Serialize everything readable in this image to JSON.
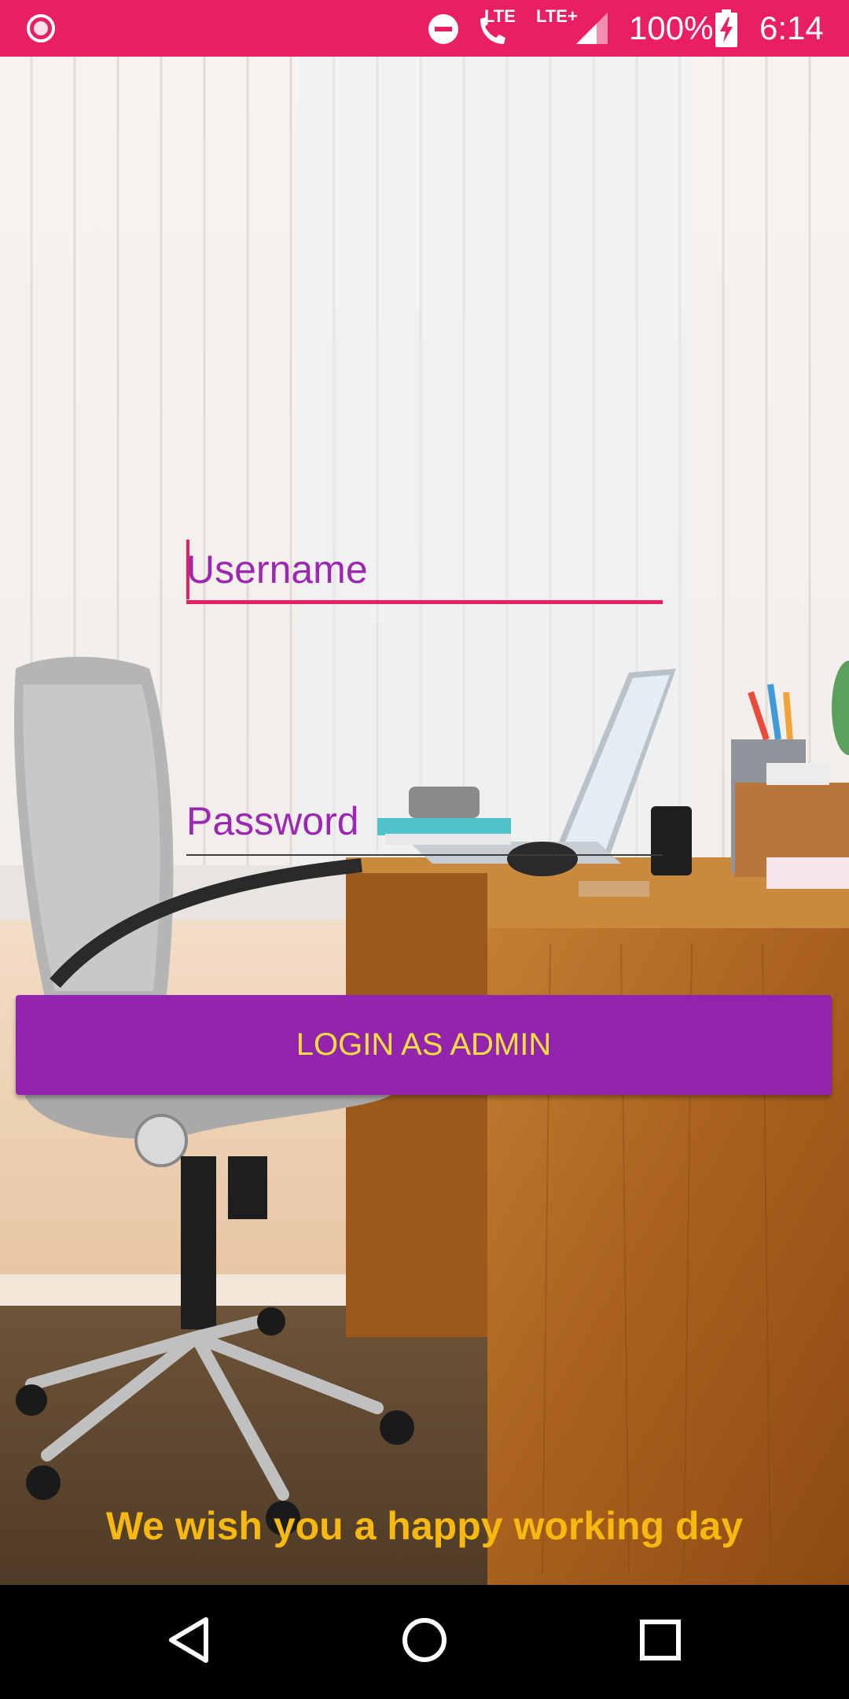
{
  "status_bar": {
    "battery_text": "100%",
    "time": "6:14",
    "network_1": "LTE",
    "network_2": "LTE+",
    "icons": [
      "recording-dot-icon",
      "do-not-disturb-icon",
      "wifi-calling-icon",
      "signal-icon",
      "battery-charging-icon"
    ]
  },
  "login_form": {
    "username_placeholder": "Username",
    "password_placeholder": "Password",
    "login_button_label": "LOGIN AS ADMIN"
  },
  "footer": {
    "tagline": "We wish you a happy working day"
  },
  "navigation": {
    "icons": [
      "back-icon",
      "home-icon",
      "recents-icon"
    ]
  },
  "colors": {
    "status_bar": "#e91e63",
    "accent_pink": "#e91e63",
    "primary_purple": "#9224b0",
    "button_text_yellow": "#ffe03a",
    "tagline_yellow": "#f7b90f",
    "navbar": "#000000"
  }
}
